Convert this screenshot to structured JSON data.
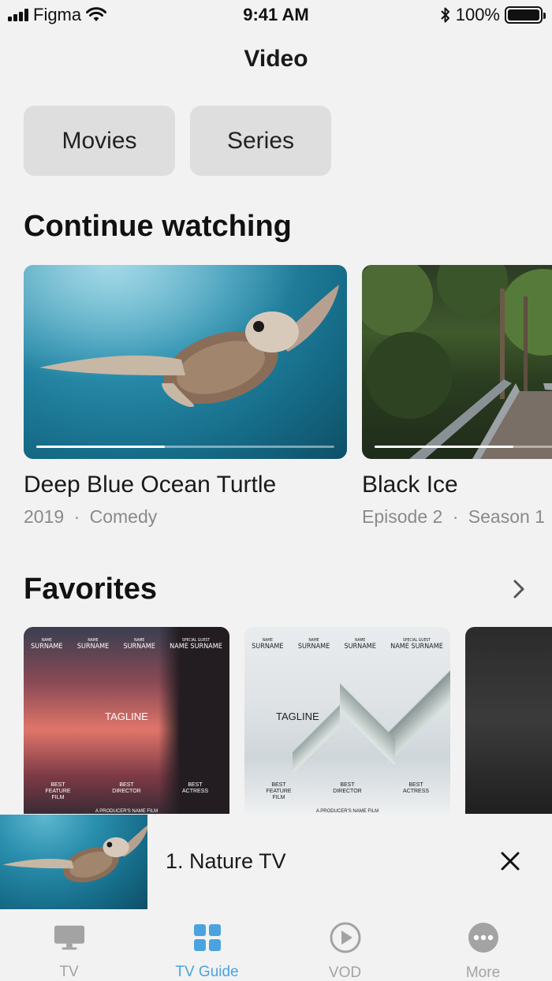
{
  "status_bar": {
    "carrier": "Figma",
    "time": "9:41 AM",
    "battery": "100%"
  },
  "header": {
    "title": "Video"
  },
  "filters": [
    {
      "label": "Movies"
    },
    {
      "label": "Series"
    }
  ],
  "continue_watching": {
    "title": "Continue watching",
    "items": [
      {
        "title": "Deep Blue Ocean Turtle",
        "meta_1": "2019",
        "separator": "·",
        "meta_2": "Comedy",
        "progress": 0.43
      },
      {
        "title": "Black Ice",
        "meta_1": "Episode 2",
        "separator": "·",
        "meta_2": "Season 1",
        "progress": 0.72
      }
    ]
  },
  "favorites": {
    "title": "Favorites",
    "posters": [
      {
        "names": [
          {
            "role": "NAME",
            "name": "SURNAME"
          },
          {
            "role": "NAME",
            "name": "SURNAME"
          },
          {
            "role": "NAME",
            "name": "SURNAME"
          },
          {
            "role": "SPECIAL GUEST",
            "name": "NAME SURNAME"
          }
        ],
        "tagline": "TAGLINE",
        "awards": [
          "BEST FEATURE FILM",
          "BEST DIRECTOR",
          "BEST ACTRESS"
        ],
        "footer": "A PRODUCER'S NAME FILM"
      },
      {
        "names": [
          {
            "role": "NAME",
            "name": "SURNAME"
          },
          {
            "role": "NAME",
            "name": "SURNAME"
          },
          {
            "role": "NAME",
            "name": "SURNAME"
          },
          {
            "role": "SPECIAL GUEST",
            "name": "NAME SURNAME"
          }
        ],
        "tagline": "TAGLINE",
        "awards": [
          "BEST FEATURE FILM",
          "BEST DIRECTOR",
          "BEST ACTRESS"
        ],
        "footer": "A PRODUCER'S NAME FILM"
      }
    ]
  },
  "mini_player": {
    "title": "1. Nature TV"
  },
  "tabs": [
    {
      "label": "TV",
      "icon": "tv-icon",
      "active": false
    },
    {
      "label": "TV Guide",
      "icon": "grid-icon",
      "active": true
    },
    {
      "label": "VOD",
      "icon": "play-circle-icon",
      "active": false
    },
    {
      "label": "More",
      "icon": "more-icon",
      "active": false
    }
  ],
  "colors": {
    "accent": "#4aa3df",
    "inactive_tab": "#a3a3a3",
    "background": "#f2f2f2"
  }
}
